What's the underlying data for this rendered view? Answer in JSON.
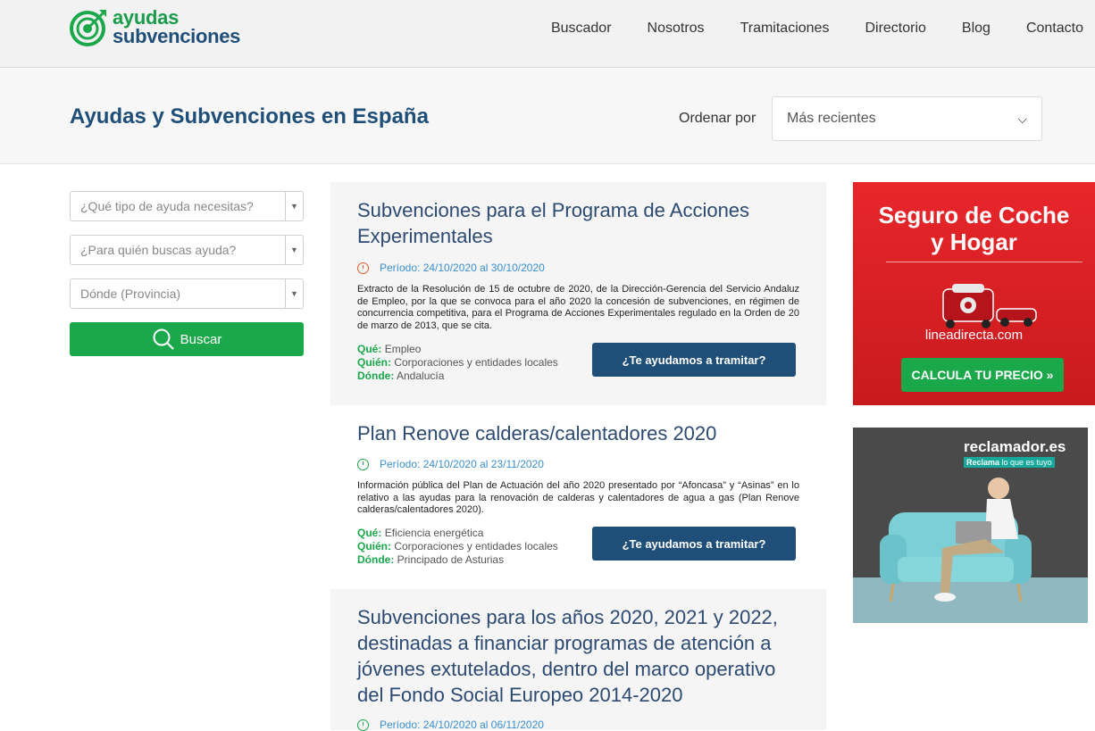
{
  "header": {
    "logo_line1": "ayudas",
    "logo_line2": "subvenciones",
    "nav": [
      "Buscador",
      "Nosotros",
      "Tramitaciones",
      "Directorio",
      "Blog",
      "Contacto"
    ]
  },
  "titlebar": {
    "title": "Ayudas y Subvenciones en España",
    "order_label": "Ordenar por",
    "order_value": "Más recientes"
  },
  "filters": {
    "tipo_placeholder": "¿Qué tipo de ayuda necesitas?",
    "quien_placeholder": "¿Para quién buscas ayuda?",
    "donde_placeholder": "Dónde (Provincia)",
    "search_label": "Buscar"
  },
  "results": [
    {
      "title": "Subvenciones para el Programa de Acciones Experimentales",
      "period": "Período: 24/10/2020 al 30/10/2020",
      "description": "Extracto de la Resolución de 15 de octubre de 2020, de la Dirección-Gerencia del Servicio Andaluz de Empleo, por la que se convoca para el año 2020 la concesión de subvenciones, en régimen de concurrencia competitiva, para el Programa de Acciones Experimentales regulado en la Orden de 20 de marzo de 2013, que se cita.",
      "que_label": "Qué:",
      "que": "Empleo",
      "quien_label": "Quién:",
      "quien": "Corporaciones y entidades locales",
      "donde_label": "Dónde:",
      "donde": "Andalucía",
      "cta": "¿Te ayudamos a tramitar?"
    },
    {
      "title": "Plan Renove calderas/calentadores 2020",
      "period": "Período: 24/10/2020 al 23/11/2020",
      "description": "Información pública del Plan de Actuación del año 2020 presentado por “Afoncasa” y “Asinas” en lo relativo a las ayudas para la renovación de calderas y calentadores de agua a gas (Plan Renove calderas/calentadores 2020).",
      "que_label": "Qué:",
      "que": "Eficiencia energética",
      "quien_label": "Quién:",
      "quien": "Corporaciones y entidades locales",
      "donde_label": "Dónde:",
      "donde": "Principado de Asturias",
      "cta": "¿Te ayudamos a tramitar?"
    },
    {
      "title": "Subvenciones para los años 2020, 2021 y 2022, destinadas a financiar programas de atención a jóvenes extutelados, dentro del marco operativo del Fondo Social Europeo 2014-2020",
      "period": "Período: 24/10/2020 al 06/11/2020"
    }
  ],
  "ads": {
    "ad1_headline_1": "Seguro de Coche",
    "ad1_headline_2": "y Hogar",
    "ad1_brand": "lineadirecta.com",
    "ad1_cta": "CALCULA TU PRECIO »",
    "ad2_brand": "reclamador.es",
    "ad2_tag_bold": "Reclama",
    "ad2_tag_rest": " lo que es tuyo"
  },
  "colors": {
    "brand_green": "#1aa84b",
    "brand_blue": "#1f4e79",
    "title_blue": "#2c4a73",
    "period_blue": "#3b8fd1",
    "ad_red": "#e8262a"
  }
}
